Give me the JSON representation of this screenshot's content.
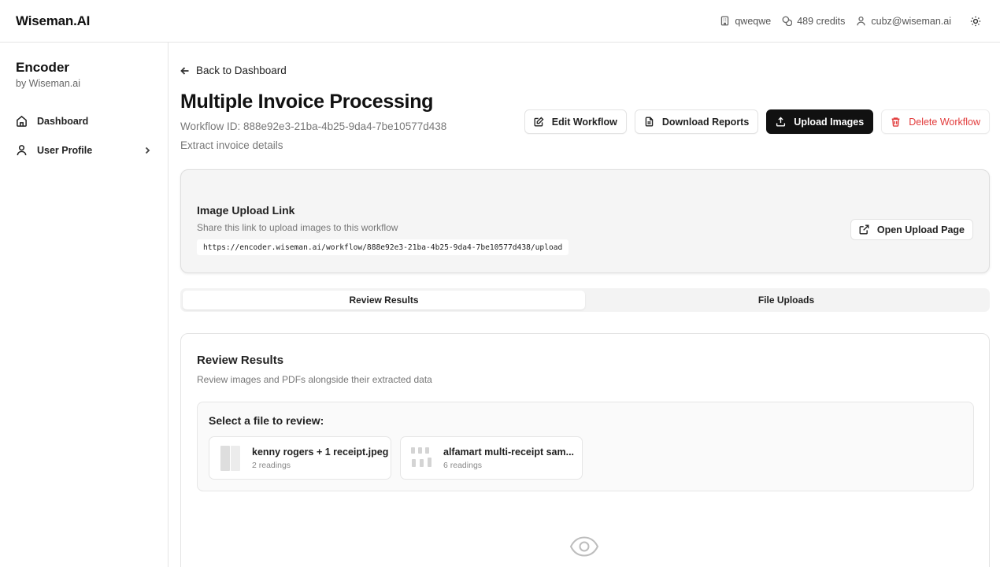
{
  "topbar": {
    "brand": "Wiseman.AI",
    "org": "qweqwe",
    "credits": "489 credits",
    "email": "cubz@wiseman.ai"
  },
  "sidebar": {
    "app_name": "Encoder",
    "app_by": "by Wiseman.ai",
    "items": [
      {
        "label": "Dashboard",
        "icon": "home-icon"
      },
      {
        "label": "User Profile",
        "icon": "user-icon"
      }
    ]
  },
  "header": {
    "back_label": "Back to Dashboard",
    "title": "Multiple Invoice Processing",
    "workflow_id": "Workflow ID: 888e92e3-21ba-4b25-9da4-7be10577d438",
    "description": "Extract invoice details"
  },
  "actions": {
    "edit": "Edit Workflow",
    "download": "Download Reports",
    "upload": "Upload Images",
    "delete": "Delete Workflow"
  },
  "upload_link": {
    "title": "Image Upload Link",
    "subtitle": "Share this link to upload images to this workflow",
    "url": "https://encoder.wiseman.ai/workflow/888e92e3-21ba-4b25-9da4-7be10577d438/upload",
    "open_label": "Open Upload Page"
  },
  "tabs": [
    {
      "label": "Review Results",
      "active": true
    },
    {
      "label": "File Uploads",
      "active": false
    }
  ],
  "review": {
    "title": "Review Results",
    "subtitle": "Review images and PDFs alongside their extracted data",
    "select_label": "Select a file to review:",
    "files": [
      {
        "name": "kenny rogers + 1 receipt.jpeg",
        "readings": "2 readings"
      },
      {
        "name": "alfamart multi-receipt sam...",
        "readings": "6 readings"
      }
    ]
  },
  "colors": {
    "primary": "#111111",
    "danger": "#e23b3b",
    "muted": "#777777"
  }
}
